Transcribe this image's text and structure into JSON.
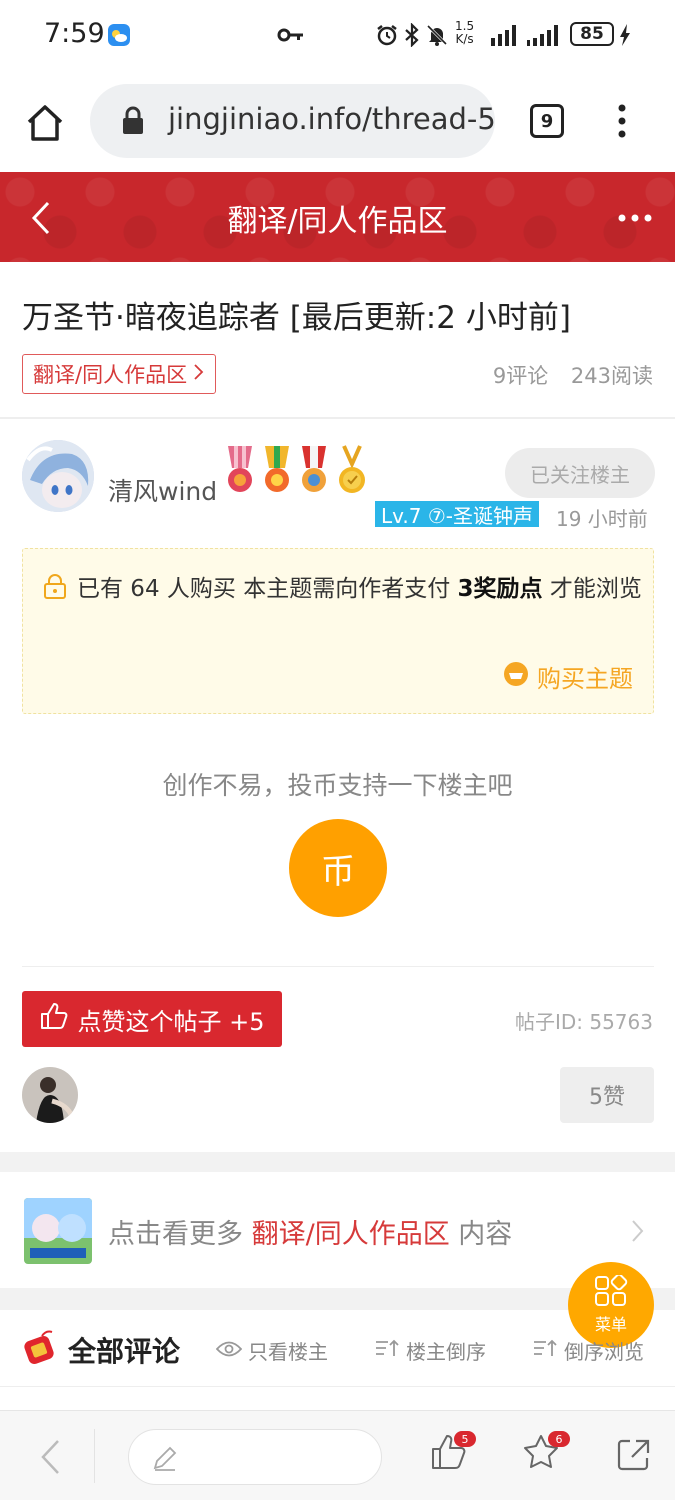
{
  "status_bar": {
    "time": "7:59",
    "net_speed_value": "1.5",
    "net_speed_unit": "K/s",
    "battery": "85"
  },
  "browser": {
    "url": "jingjiniao.info/thread-5",
    "tab_count": "9"
  },
  "header": {
    "title": "翻译/同人作品区"
  },
  "thread": {
    "title": "万圣节·暗夜追踪者 [最后更新:2 小时前]",
    "forum_tag": "翻译/同人作品区",
    "comments": "9评论",
    "reads": "243阅读"
  },
  "author": {
    "name": "清风wind",
    "follow_label": "已关注楼主",
    "level": "Lv.7 ⑦-圣诞钟声",
    "time": "19 小时前"
  },
  "paywall": {
    "text_pre": "已有 64 人购买 本主题需向作者支付 ",
    "amount": "3奖励点",
    "text_post": " 才能浏览",
    "buy_label": "购买主题"
  },
  "support": {
    "text": "创作不易，投币支持一下楼主吧",
    "coin_label": "币"
  },
  "actions": {
    "like_label": "点赞这个帖子 +5",
    "post_id": "帖子ID: 55763",
    "likes_count": "5赞"
  },
  "more": {
    "pre": "点击看更多 ",
    "forum": "翻译/同人作品区",
    "post": " 内容"
  },
  "fab": {
    "label": "菜单"
  },
  "comments_section": {
    "title": "全部评论",
    "only_op": "只看楼主",
    "op_reverse": "楼主倒序",
    "reverse_browse": "倒序浏览"
  },
  "bottom_bar": {
    "like_badge": "5",
    "star_badge": "6"
  },
  "colors": {
    "brand_red": "#c8272c",
    "accent_orange": "#ffa000",
    "level_blue": "#2bb5e8"
  }
}
